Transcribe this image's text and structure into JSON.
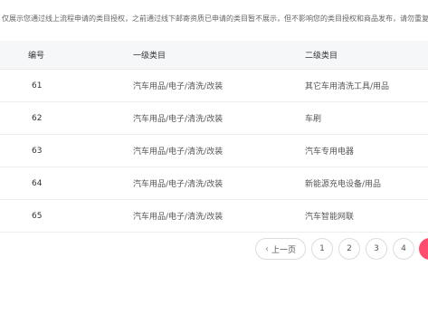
{
  "notice": "仅展示您通过线上流程申请的类目授权，之前通过线下邮寄资质已申请的类目暂不展示，但不影响您的类目授权和商品发布，请勿重复申请",
  "table": {
    "headers": [
      "编号",
      "一级类目",
      "二级类目"
    ],
    "rows": [
      {
        "id": "61",
        "category1": "汽车用品/电子/清洗/改装",
        "category2": "其它车用清洗工具/用品"
      },
      {
        "id": "62",
        "category1": "汽车用品/电子/清洗/改装",
        "category2": "车刷"
      },
      {
        "id": "63",
        "category1": "汽车用品/电子/清洗/改装",
        "category2": "汽车专用电器"
      },
      {
        "id": "64",
        "category1": "汽车用品/电子/清洗/改装",
        "category2": "新能源充电设备/用品"
      },
      {
        "id": "65",
        "category1": "汽车用品/电子/清洗/改装",
        "category2": "汽车智能网联"
      }
    ]
  },
  "pagination": {
    "prev_label": "上一页",
    "prev_icon": "chevron-left-icon",
    "pages": [
      "1",
      "2",
      "3",
      "4"
    ],
    "active_color": "#ff4d6d"
  }
}
